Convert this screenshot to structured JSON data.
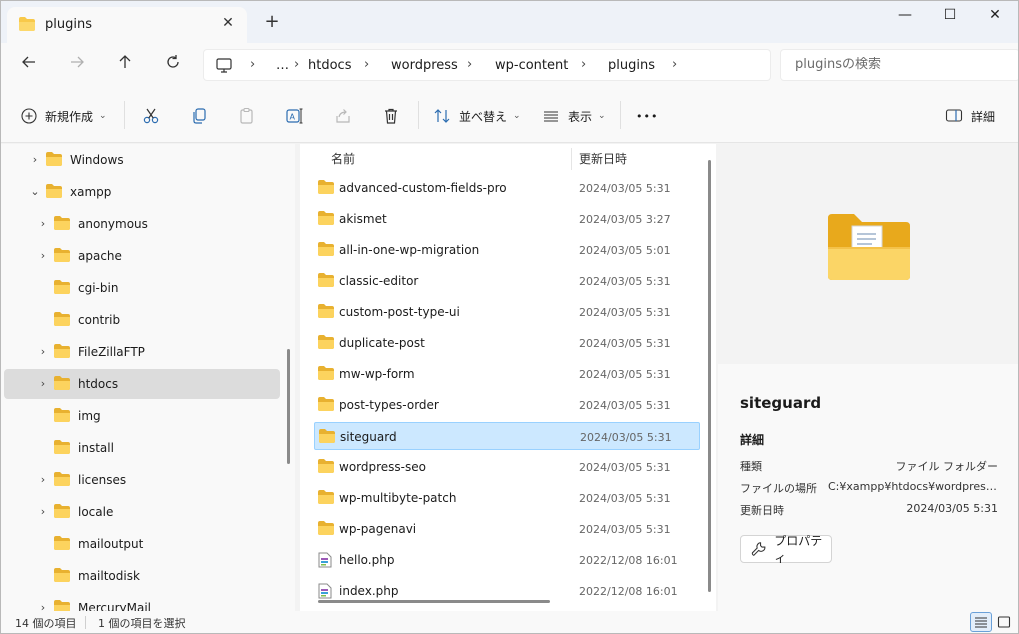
{
  "tab": {
    "title": "plugins",
    "close_icon": "close-icon",
    "new_tab_label": "+"
  },
  "window_controls": {
    "minimize": "—",
    "maximize": "☐",
    "close": "✕"
  },
  "address": {
    "breadcrumbs": [
      "htdocs",
      "wordpress",
      "wp-content",
      "plugins"
    ],
    "overflow": "…",
    "separator": "›"
  },
  "search": {
    "placeholder": "pluginsの検索"
  },
  "toolbar": {
    "new_label": "新規作成",
    "sort_label": "並べ替え",
    "view_label": "表示",
    "more_label": "•••",
    "details_label": "詳細"
  },
  "nav": {
    "items": [
      {
        "label": "Windows",
        "level": 0,
        "expander": "›",
        "selected": false
      },
      {
        "label": "xampp",
        "level": 0,
        "expander": "⌄",
        "selected": false
      },
      {
        "label": "anonymous",
        "level": 1,
        "expander": "›",
        "selected": false
      },
      {
        "label": "apache",
        "level": 1,
        "expander": "›",
        "selected": false
      },
      {
        "label": "cgi-bin",
        "level": 1,
        "expander": "",
        "selected": false
      },
      {
        "label": "contrib",
        "level": 1,
        "expander": "",
        "selected": false
      },
      {
        "label": "FileZillaFTP",
        "level": 1,
        "expander": "›",
        "selected": false
      },
      {
        "label": "htdocs",
        "level": 1,
        "expander": "›",
        "selected": true
      },
      {
        "label": "img",
        "level": 1,
        "expander": "",
        "selected": false
      },
      {
        "label": "install",
        "level": 1,
        "expander": "",
        "selected": false
      },
      {
        "label": "licenses",
        "level": 1,
        "expander": "›",
        "selected": false
      },
      {
        "label": "locale",
        "level": 1,
        "expander": "›",
        "selected": false
      },
      {
        "label": "mailoutput",
        "level": 1,
        "expander": "",
        "selected": false
      },
      {
        "label": "mailtodisk",
        "level": 1,
        "expander": "",
        "selected": false
      },
      {
        "label": "MercuryMail",
        "level": 1,
        "expander": "›",
        "selected": false
      }
    ]
  },
  "files": {
    "columns": {
      "name": "名前",
      "modified": "更新日時",
      "sort_indicator": "⌃"
    },
    "rows": [
      {
        "name": "advanced-custom-fields-pro",
        "modified": "2024/03/05 5:31",
        "type": "folder",
        "selected": false
      },
      {
        "name": "akismet",
        "modified": "2024/03/05 3:27",
        "type": "folder",
        "selected": false
      },
      {
        "name": "all-in-one-wp-migration",
        "modified": "2024/03/05 5:01",
        "type": "folder",
        "selected": false
      },
      {
        "name": "classic-editor",
        "modified": "2024/03/05 5:31",
        "type": "folder",
        "selected": false
      },
      {
        "name": "custom-post-type-ui",
        "modified": "2024/03/05 5:31",
        "type": "folder",
        "selected": false
      },
      {
        "name": "duplicate-post",
        "modified": "2024/03/05 5:31",
        "type": "folder",
        "selected": false
      },
      {
        "name": "mw-wp-form",
        "modified": "2024/03/05 5:31",
        "type": "folder",
        "selected": false
      },
      {
        "name": "post-types-order",
        "modified": "2024/03/05 5:31",
        "type": "folder",
        "selected": false
      },
      {
        "name": "siteguard",
        "modified": "2024/03/05 5:31",
        "type": "folder",
        "selected": true
      },
      {
        "name": "wordpress-seo",
        "modified": "2024/03/05 5:31",
        "type": "folder",
        "selected": false
      },
      {
        "name": "wp-multibyte-patch",
        "modified": "2024/03/05 5:31",
        "type": "folder",
        "selected": false
      },
      {
        "name": "wp-pagenavi",
        "modified": "2024/03/05 5:31",
        "type": "folder",
        "selected": false
      },
      {
        "name": "hello.php",
        "modified": "2022/12/08 16:01",
        "type": "php",
        "selected": false
      },
      {
        "name": "index.php",
        "modified": "2022/12/08 16:01",
        "type": "php",
        "selected": false
      }
    ]
  },
  "details": {
    "title": "siteguard",
    "section": "詳細",
    "fields": [
      {
        "label": "種類",
        "value": "ファイル フォルダー"
      },
      {
        "label": "ファイルの場所",
        "value": "C:¥xampp¥htdocs¥wordpress..."
      },
      {
        "label": "更新日時",
        "value": "2024/03/05 5:31"
      }
    ],
    "properties_label": "プロパティ"
  },
  "status": {
    "item_count": "14 個の項目",
    "selected_count": "1 個の項目を選択"
  },
  "colors": {
    "folder": "#f8c94a",
    "selection": "#cce8ff",
    "nav_selection": "#dcdcdc"
  }
}
